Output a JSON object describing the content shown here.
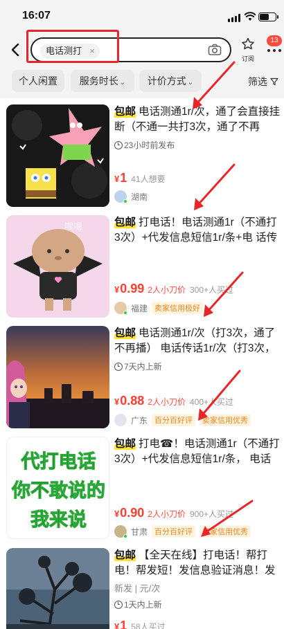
{
  "status": {
    "time": "16:07"
  },
  "search": {
    "query": "电话测打",
    "clear": "×"
  },
  "nav": {
    "subscribe_label": "订阅",
    "badge": "13"
  },
  "filters": [
    {
      "label": "个人闲置",
      "caret": ""
    },
    {
      "label": "服务时长",
      "caret": "⌄"
    },
    {
      "label": "计价方式",
      "caret": "⌄"
    }
  ],
  "filter_btn": "筛选",
  "items": [
    {
      "baoyou": "包邮",
      "title": "电话测通1r/次，通了会直接挂断（不通一共打3次，通了不再",
      "tag": "23小时前发布",
      "price_currency": "¥",
      "price": "1",
      "cut": "",
      "want": "41人想要",
      "location": "湖南",
      "badges": []
    },
    {
      "baoyou": "包邮",
      "title": "打电话！电话测通1r（不通打3次）+代发信息短信1r/条+电 话传",
      "tag": "",
      "price_currency": "¥",
      "price": "0.99",
      "cut": "2人小刀价",
      "want": "300+人买过",
      "location": "福建",
      "badges": [
        "卖家信用极好"
      ]
    },
    {
      "baoyou": "包邮",
      "title": "电话测通1r/次（打3次，通了不再播） 电话传话1r/次（打3次，",
      "tag": "7天内上新",
      "price_currency": "¥",
      "price": "0.88",
      "cut": "2人小刀价",
      "want": "400+人买过",
      "location": "广东",
      "badges": [
        "百分百好评",
        "卖家信用优秀"
      ]
    },
    {
      "baoyou": "包邮",
      "title": "打电☎！电话测通1r（不通打3次）+代发信息短信1r/条， 电话",
      "tag": "",
      "price_currency": "¥",
      "price": "0.90",
      "cut": "2人小刀价",
      "want": "900+人买过",
      "location": "甘肃",
      "badges": [
        "百分百好评",
        "卖家信用优秀"
      ]
    },
    {
      "baoyou": "包邮",
      "title": "【全天在线】打电话！帮打电！帮发短！发信息验证消息！发",
      "tag": "新发 | 元/次",
      "tag2": "1天内上新",
      "price_currency": "¥",
      "price": "1",
      "cut": "",
      "want": "58人买过",
      "location": "",
      "badges": []
    }
  ],
  "thumb_texts": {
    "item2_watermark": "嘿嘿",
    "item4_line1": "代打电话",
    "item4_line2": "你不敢说的",
    "item4_line3": "我来说"
  },
  "colors": {
    "accent_red": "#ff3d2f",
    "annotation_red": "#e8262a",
    "highlight_yellow": "#ffe23a"
  }
}
